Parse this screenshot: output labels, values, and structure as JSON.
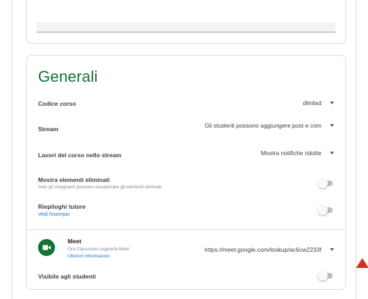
{
  "general": {
    "title": "Generali",
    "class_code": {
      "label": "Codice corso",
      "value": "dlmlixd"
    },
    "stream": {
      "label": "Stream",
      "value": "Gli studenti possono aggiungere post e com"
    },
    "classwork_stream": {
      "label": "Lavori del corso nello stream",
      "value": "Mostra notifiche ridotte"
    },
    "show_deleted": {
      "label": "Mostra elementi eliminati",
      "description": "Solo gli insegnanti possono visualizzare gli elementi eliminati."
    },
    "guardian_summaries": {
      "label": "Riepiloghi tutore",
      "link": "Vedi l'esempio"
    },
    "meet": {
      "label": "Meet",
      "description": "Ora Classroom supporta Meet",
      "link": "Ulteriori informazioni",
      "url": "https://meet.google.com/lookup/ac6cw2233f"
    },
    "visible_to_students": {
      "label": "Visibile agli studenti"
    }
  },
  "colors": {
    "accent_green": "#137333",
    "link_blue": "#1a73e8",
    "annotation_red": "#d93025"
  },
  "icons": {
    "meet": "video-camera-icon",
    "dropdown": "caret-down-icon",
    "annotation": "red-arrow-icon"
  }
}
